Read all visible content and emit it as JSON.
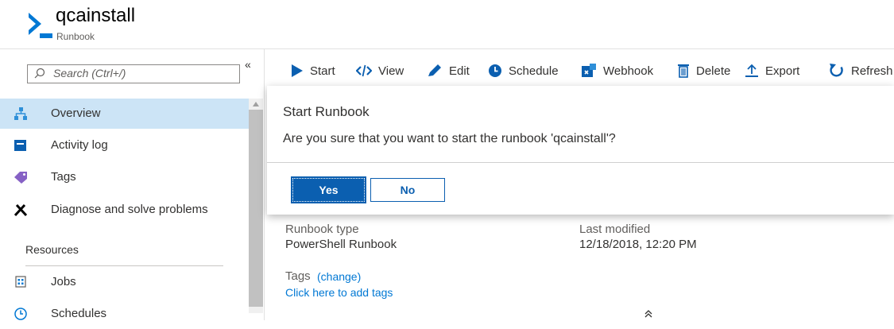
{
  "header": {
    "title": "qcainstall",
    "subtitle": "Runbook"
  },
  "search": {
    "placeholder": "Search (Ctrl+/)"
  },
  "sidebar": {
    "collapse_glyph": "«",
    "items": [
      {
        "label": "Overview",
        "icon": "overview-icon",
        "selected": true
      },
      {
        "label": "Activity log",
        "icon": "activity-log-icon"
      },
      {
        "label": "Tags",
        "icon": "tag-icon"
      },
      {
        "label": "Diagnose and solve problems",
        "icon": "wrench-icon"
      }
    ],
    "section_resources": "Resources",
    "resource_items": [
      {
        "label": "Jobs",
        "icon": "jobs-icon"
      },
      {
        "label": "Schedules",
        "icon": "clock-icon"
      }
    ]
  },
  "toolbar": {
    "start": "Start",
    "view": "View",
    "edit": "Edit",
    "schedule": "Schedule",
    "webhook": "Webhook",
    "delete": "Delete",
    "export": "Export",
    "refresh": "Refresh"
  },
  "dialog": {
    "title": "Start Runbook",
    "message": "Are you sure that you want to start the runbook 'qcainstall'?",
    "yes": "Yes",
    "no": "No"
  },
  "properties": {
    "runbook_type_label": "Runbook type",
    "runbook_type_value": "PowerShell Runbook",
    "last_modified_label": "Last modified",
    "last_modified_value": "12/18/2018, 12:20 PM",
    "tags_label": "Tags",
    "tags_change_link": "(change)",
    "add_tags_link": "Click here to add tags",
    "collapse_glyph": "≈"
  },
  "colors": {
    "accent": "#0078d4",
    "button_primary": "#0b5fb0",
    "selected_bg": "#cce4f6"
  }
}
